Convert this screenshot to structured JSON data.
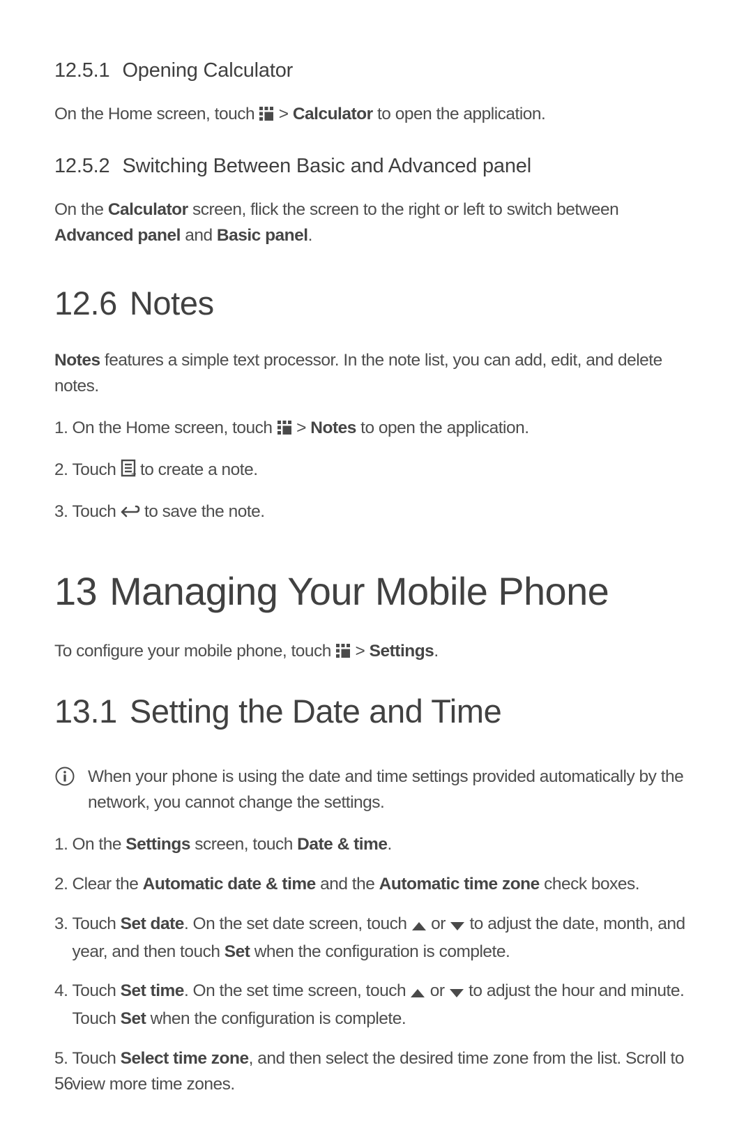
{
  "sections": {
    "s1251": {
      "number": "12.5.1",
      "title": "Opening Calculator",
      "p1a": "On the Home screen, touch ",
      "p1b": " > ",
      "p1_bold": "Calculator",
      "p1c": " to open the application."
    },
    "s1252": {
      "number": "12.5.2",
      "title": "Switching Between Basic and Advanced panel",
      "p1a": "On the ",
      "p1b": "Calculator",
      "p1c": " screen, flick the screen to the right or left to switch between ",
      "p1d": "Advanced panel",
      "p1e": " and ",
      "p1f": "Basic panel",
      "p1g": "."
    },
    "s126": {
      "number": "12.6",
      "title": "Notes",
      "p1a": "Notes",
      "p1b": " features a simple text processor. In the note list, you can add, edit, and delete notes.",
      "step1_n": "1.",
      "step1_a": "On the Home screen, touch ",
      "step1_b": " > ",
      "step1_bold": "Notes",
      "step1_c": " to open the application.",
      "step2_n": "2.",
      "step2_a": "Touch ",
      "step2_b": " to create a note.",
      "step3_n": "3.",
      "step3_a": "Touch ",
      "step3_b": " to save the note."
    },
    "s13": {
      "number": "13",
      "title": "Managing Your Mobile Phone",
      "p1a": "To configure your mobile phone, touch ",
      "p1b": " > ",
      "p1_bold": "Settings",
      "p1c": "."
    },
    "s131": {
      "number": "13.1",
      "title": "Setting the Date and Time",
      "note": "When your phone is using the date and time settings provided automatically by the network, you cannot change the settings.",
      "step1_n": "1.",
      "step1_a": "On the ",
      "step1_b": "Settings",
      "step1_c": " screen, touch ",
      "step1_d": "Date & time",
      "step1_e": ".",
      "step2_n": "2.",
      "step2_a": "Clear the ",
      "step2_b": "Automatic date & time",
      "step2_c": " and the ",
      "step2_d": "Automatic time zone",
      "step2_e": " check boxes.",
      "step3_n": "3.",
      "step3_a": "Touch ",
      "step3_b": "Set date",
      "step3_c": ". On the set date screen, touch ",
      "step3_d": " or ",
      "step3_e": " to adjust the date, month, and year, and then touch ",
      "step3_f": "Set",
      "step3_g": " when the configuration is complete.",
      "step4_n": "4.",
      "step4_a": "Touch ",
      "step4_b": "Set time",
      "step4_c": ". On the set time screen, touch ",
      "step4_d": " or ",
      "step4_e": " to adjust the hour and minute. Touch ",
      "step4_f": "Set",
      "step4_g": " when the configuration is complete.",
      "step5_n": "5.",
      "step5_a": "Touch ",
      "step5_b": "Select time zone",
      "step5_c": ", and then select the desired time zone from the list. Scroll to view more time zones."
    }
  },
  "page_number": "56"
}
